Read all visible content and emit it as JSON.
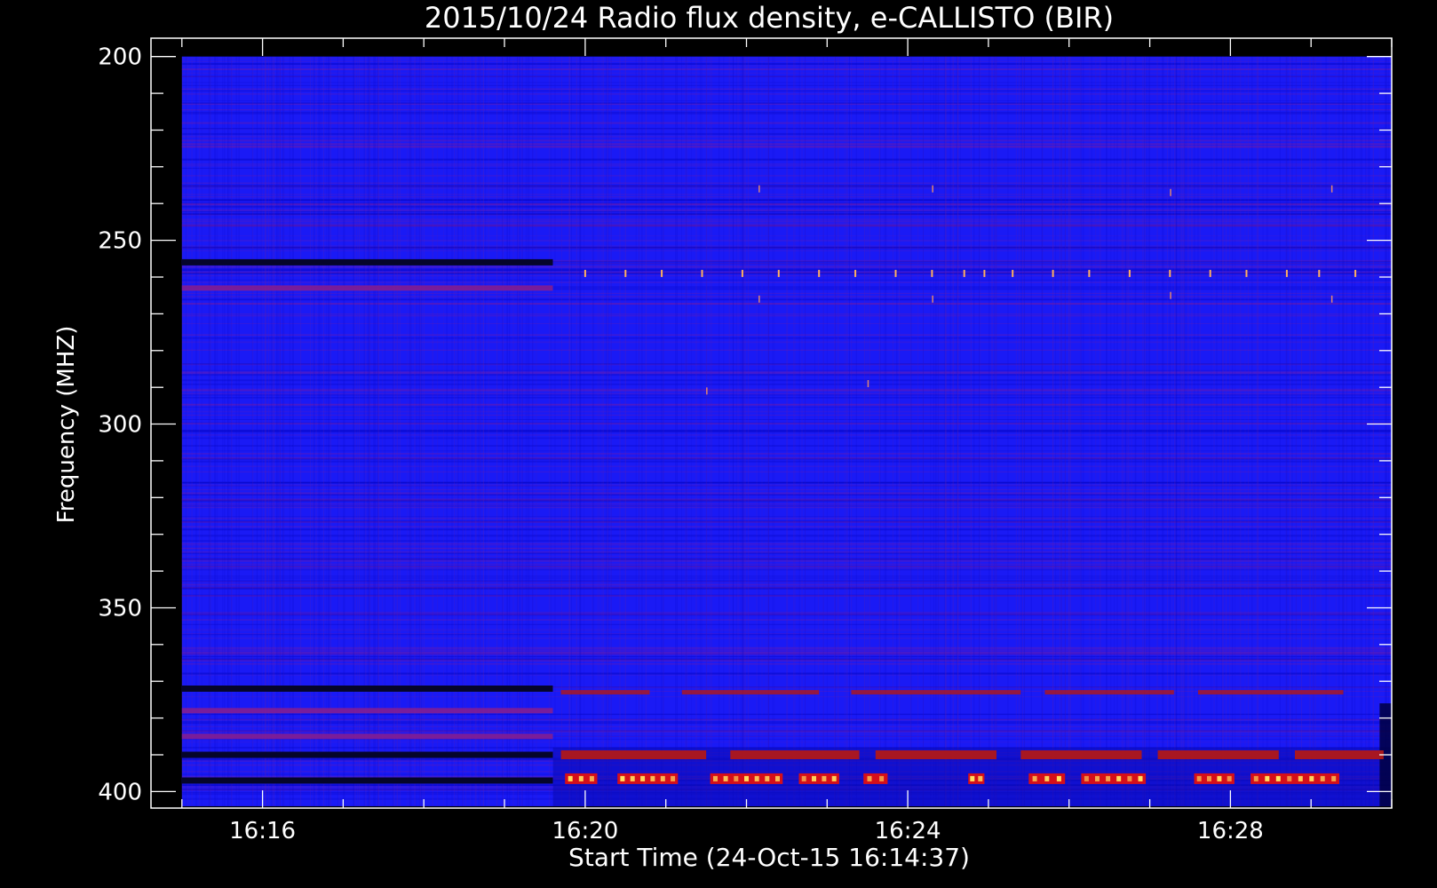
{
  "chart_data": {
    "type": "heatmap",
    "title": "2015/10/24  Radio flux density, e-CALLISTO (BIR)",
    "xlabel": "Start Time (24-Oct-15 16:14:37)",
    "ylabel": "Frequency (MHZ)",
    "x_ticks": [
      "16:16",
      "16:20",
      "16:24",
      "16:28"
    ],
    "x_tick_minutes": [
      16,
      20,
      24,
      28
    ],
    "x_range_minutes": [
      14.617,
      30.0
    ],
    "data_x_range_minutes": [
      15.0,
      30.0
    ],
    "y_ticks": [
      200,
      250,
      300,
      350,
      400
    ],
    "ylim": [
      195,
      404.5
    ],
    "data_y_range": [
      200,
      404
    ],
    "y_inverted": true,
    "colormap": {
      "low": "#0000ff",
      "mid": "#cc0000",
      "high": "#ffff66",
      "background": "#000000",
      "text": "#ffffff"
    },
    "features": {
      "instrument_change_minute": 19.6,
      "dark_bands_mhz_before_change": [
        256,
        372,
        390,
        397
      ],
      "reddish_bands_mhz_before_change": [
        263,
        378,
        385
      ],
      "interference_row_mhz": 259,
      "interference_spikes_minutes": [
        20.0,
        20.5,
        20.95,
        21.45,
        21.95,
        22.4,
        22.9,
        23.35,
        23.85,
        24.3,
        24.7,
        24.95,
        25.3,
        25.8,
        26.25,
        26.75,
        27.25,
        27.75,
        28.2,
        28.7,
        29.1,
        29.55
      ],
      "strong_emission_bands": [
        {
          "mhz": 396.5,
          "segments": [
            [
              19.75,
              20.15
            ],
            [
              20.4,
              21.15
            ],
            [
              21.55,
              22.45
            ],
            [
              22.65,
              23.15
            ],
            [
              23.45,
              23.75
            ],
            [
              24.75,
              24.95
            ],
            [
              25.5,
              25.95
            ],
            [
              26.15,
              26.95
            ],
            [
              27.55,
              28.05
            ],
            [
              28.25,
              29.35
            ]
          ]
        },
        {
          "mhz": 390,
          "segments": [
            [
              19.7,
              21.5
            ],
            [
              21.8,
              23.4
            ],
            [
              23.6,
              25.1
            ],
            [
              25.4,
              26.9
            ],
            [
              27.1,
              28.6
            ],
            [
              28.8,
              29.9
            ]
          ]
        },
        {
          "mhz": 373,
          "segments": [
            [
              19.7,
              20.8
            ],
            [
              21.2,
              22.9
            ],
            [
              23.3,
              25.4
            ],
            [
              25.7,
              27.3
            ],
            [
              27.6,
              29.4
            ]
          ]
        }
      ]
    }
  }
}
